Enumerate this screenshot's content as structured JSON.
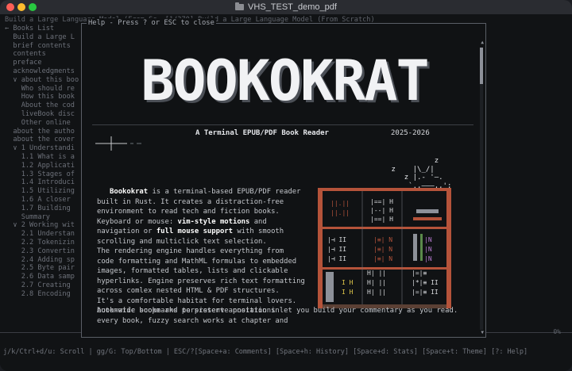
{
  "window": {
    "title": "VHS_TEST_demo_pdf",
    "traffic_colors": [
      "#ff5f57",
      "#febc2e",
      "#28c840"
    ]
  },
  "terminal": {
    "header": "Build a Large Language Model (From Sc  [1/370] Build a Large Language Model (From Scratch)",
    "left_items": [
      "← Books List",
      "  Build a Large L",
      "  brief contents",
      "  contents",
      "  preface",
      "  acknowledgments",
      "  ∨ about this boo",
      "    Who should re",
      "    How this book",
      "    About the cod",
      "    liveBook disc",
      "    Other online",
      "  about the autho",
      "  about the cover",
      "  ∨ 1 Understandi",
      "    1.1 What is a",
      "    1.2 Applicati",
      "    1.3 Stages of",
      "    1.4 Introduci",
      "    1.5 Utilizing",
      "    1.6 A closer",
      "    1.7 Building",
      "    Summary",
      "  ∨ 2 Working wit",
      "    2.1 Understan",
      "    2.2 Tokenizin",
      "    2.3 Convertin",
      "    2.4 Adding sp",
      "    2.5 Byte pair",
      "    2.6 Data samp",
      "    2.7 Creating",
      "    2.8 Encoding"
    ],
    "percent": "0%",
    "status_bar": "j/k/Ctrl+d/u: Scroll | gg/G: Top/Bottom | ESC/?[Space+a: Comments] [Space+h: History] [Space+d: Stats] [Space+t: Theme] [?: Help]"
  },
  "help_modal": {
    "title": "Help - Press ? or ESC to close",
    "logo_text": "BOOKOKRAT",
    "subtitle": "A Terminal EPUB/PDF Book Reader",
    "years": "2025-2026",
    "cat_art": [
      "                z",
      "      z    |\\_/|",
      "         z |.- '—.",
      "          `.,———,,';"
    ],
    "intro_bold": "Bookokrat",
    "paragraph_lines": [
      " is a terminal-based EPUB/PDF reader",
      "built in Rust. It creates a distraction-free",
      "environment to read tech and fiction books.",
      "Keyboard or mouse: ",
      "navigation or ",
      "scrolling and multiclick text selection.",
      "The rendering engine handles everything from",
      "code formatting and MathML formulas to embedded",
      "images, formatted tables, lists and clickable",
      "hyperlinks. Engine preserves rich text formatting",
      "across comlex nested HTML & PDF structures.",
      "It's a comfortable habitat for terminal lovers.",
      "Automatic bookmarks to preserve position in",
      "every book, fuzzy search works at chapter and"
    ],
    "vim_bold": "vim-style motions",
    "vim_after": " and",
    "mouse_bold": "full mouse support",
    "mouse_after": " with smooth",
    "last_line": "book-wide scope and persistent annotations let you build your commentary as you read."
  }
}
